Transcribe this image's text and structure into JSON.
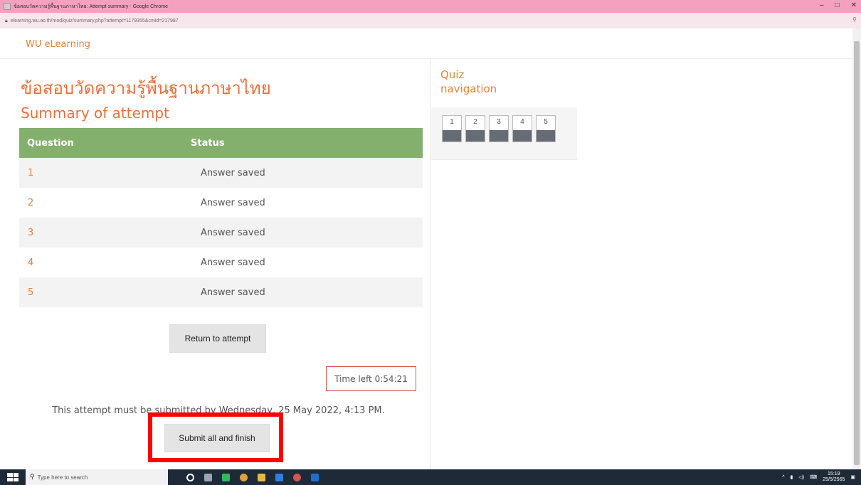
{
  "browser": {
    "window_title": "ข้อสอบวัดความรู้พื้นฐานภาษาไทย: Attempt summary - Google Chrome",
    "url": "elearning.wu.ac.th/mod/quiz/summary.php?attempt=1179355&cmid=217987",
    "controls": {
      "minimize": "–",
      "maximize": "□",
      "close": "✕"
    }
  },
  "site": {
    "brand": "WU eLearning"
  },
  "quiz": {
    "thai_title": "ข้อสอบวัดความรู้พื้นฐานภาษาไทย",
    "summary_title": "Summary of attempt",
    "table": {
      "headers": {
        "question": "Question",
        "status": "Status"
      },
      "rows": [
        {
          "question": "1",
          "status": "Answer saved"
        },
        {
          "question": "2",
          "status": "Answer saved"
        },
        {
          "question": "3",
          "status": "Answer saved"
        },
        {
          "question": "4",
          "status": "Answer saved"
        },
        {
          "question": "5",
          "status": "Answer saved"
        }
      ]
    },
    "return_button": "Return to attempt",
    "time_left": "Time left 0:54:21",
    "deadline_text": "This attempt must be submitted by Wednesday, 25 May 2022, 4:13 PM.",
    "submit_button": "Submit all and finish"
  },
  "navigation": {
    "title": "Quiz navigation",
    "buttons": [
      "1",
      "2",
      "3",
      "4",
      "5"
    ]
  },
  "taskbar": {
    "search_placeholder": "Type here to search",
    "time": "15:19",
    "date": "25/5/2565"
  },
  "colors": {
    "accent": "#e8803a",
    "table_header": "#83b06d",
    "highlight": "#ff0000",
    "titlebar": "#f4a1bf"
  }
}
